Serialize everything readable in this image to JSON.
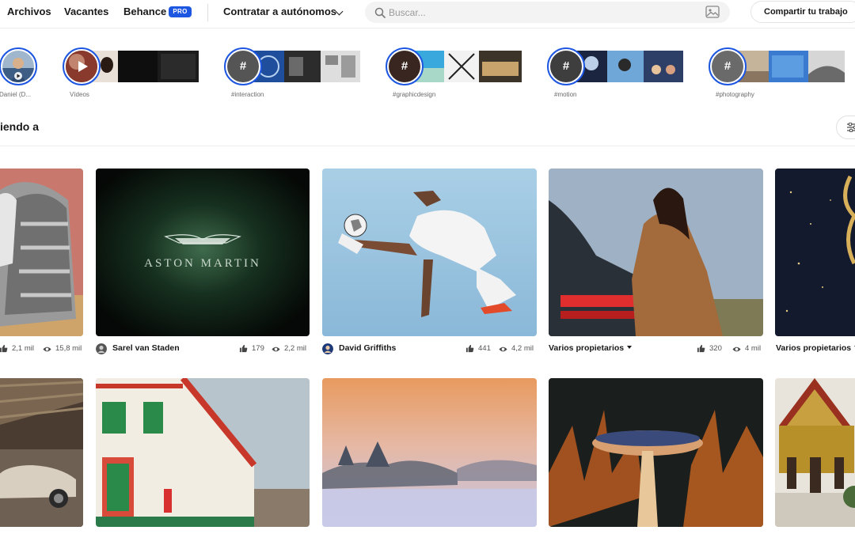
{
  "nav": {
    "links": [
      "Archivos",
      "Vacantes",
      "Behance"
    ],
    "pro_badge": "PRO",
    "hire_menu": "Contratar a autónomos",
    "search_placeholder": "Buscar...",
    "post_job": "Compartir tu trabajo"
  },
  "stories": [
    {
      "label": "Daniel (D...",
      "kind": "profile"
    },
    {
      "label": "Vídeos",
      "kind": "video"
    },
    {
      "label": "#interaction",
      "kind": "hashtag",
      "symbol": "#"
    },
    {
      "label": "#graphicdesign",
      "kind": "hashtag",
      "symbol": "#"
    },
    {
      "label": "#motion",
      "kind": "hashtag",
      "symbol": "#"
    },
    {
      "label": "#photography",
      "kind": "hashtag",
      "symbol": "#"
    }
  ],
  "section": {
    "title": "iendo a"
  },
  "cards": [
    {
      "owner": "",
      "likes": "2,1 mil",
      "views": "15,8 mil"
    },
    {
      "owner": "Sarel van Staden",
      "likes": "179",
      "views": "2,2 mil",
      "image_text": "ASTON  MARTIN"
    },
    {
      "owner": "David Griffiths",
      "likes": "441",
      "views": "4,2 mil"
    },
    {
      "owner": "Varios propietarios",
      "likes": "320",
      "views": "4 mil",
      "dropdown": true
    },
    {
      "owner": "Varios propietarios",
      "likes": "",
      "views": "",
      "dropdown": true
    }
  ],
  "colors": {
    "accent": "#1d56e0",
    "text": "#191919",
    "muted": "#6b6b6b"
  }
}
